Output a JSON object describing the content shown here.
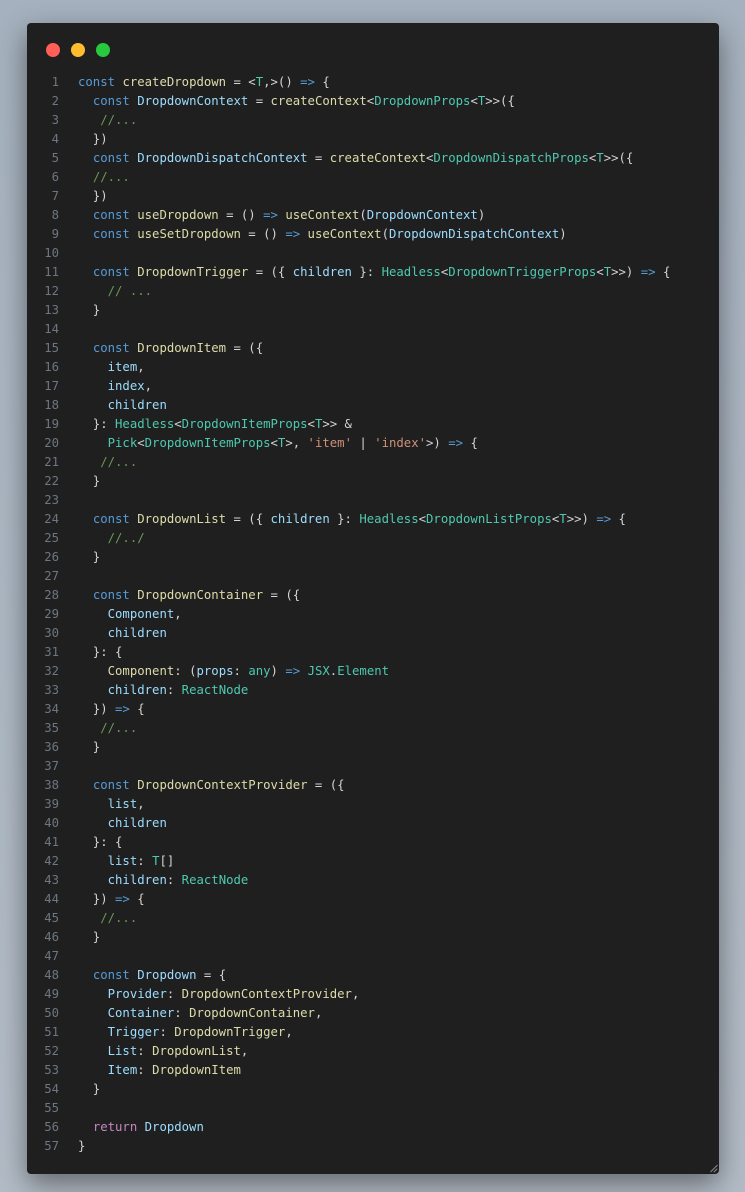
{
  "window": {
    "controls": [
      {
        "name": "close",
        "color": "#ff5f56"
      },
      {
        "name": "minimize",
        "color": "#ffbd2e"
      },
      {
        "name": "zoom",
        "color": "#27c93f"
      }
    ]
  },
  "code": {
    "language": "typescript",
    "lines": [
      {
        "n": "1",
        "tokens": [
          [
            "k",
            "const"
          ],
          [
            "p",
            " "
          ],
          [
            "f",
            "createDropdown"
          ],
          [
            "p",
            " = <"
          ],
          [
            "t",
            "T"
          ],
          [
            "p",
            ",>() "
          ],
          [
            "k",
            "=>"
          ],
          [
            "p",
            " {"
          ]
        ]
      },
      {
        "n": "2",
        "tokens": [
          [
            "p",
            "  "
          ],
          [
            "k",
            "const"
          ],
          [
            "p",
            " "
          ],
          [
            "v",
            "DropdownContext"
          ],
          [
            "p",
            " = "
          ],
          [
            "f",
            "createContext"
          ],
          [
            "p",
            "<"
          ],
          [
            "t",
            "DropdownProps"
          ],
          [
            "p",
            "<"
          ],
          [
            "t",
            "T"
          ],
          [
            "p",
            ">>({"
          ]
        ]
      },
      {
        "n": "3",
        "tokens": [
          [
            "p",
            "   "
          ],
          [
            "c",
            "//..."
          ]
        ]
      },
      {
        "n": "4",
        "tokens": [
          [
            "p",
            "  })"
          ]
        ]
      },
      {
        "n": "5",
        "tokens": [
          [
            "p",
            "  "
          ],
          [
            "k",
            "const"
          ],
          [
            "p",
            " "
          ],
          [
            "v",
            "DropdownDispatchContext"
          ],
          [
            "p",
            " = "
          ],
          [
            "f",
            "createContext"
          ],
          [
            "p",
            "<"
          ],
          [
            "t",
            "DropdownDispatchProps"
          ],
          [
            "p",
            "<"
          ],
          [
            "t",
            "T"
          ],
          [
            "p",
            ">>({"
          ]
        ]
      },
      {
        "n": "6",
        "tokens": [
          [
            "p",
            "  "
          ],
          [
            "c",
            "//..."
          ]
        ]
      },
      {
        "n": "7",
        "tokens": [
          [
            "p",
            "  })"
          ]
        ]
      },
      {
        "n": "8",
        "tokens": [
          [
            "p",
            "  "
          ],
          [
            "k",
            "const"
          ],
          [
            "p",
            " "
          ],
          [
            "f",
            "useDropdown"
          ],
          [
            "p",
            " = () "
          ],
          [
            "k",
            "=>"
          ],
          [
            "p",
            " "
          ],
          [
            "f",
            "useContext"
          ],
          [
            "p",
            "("
          ],
          [
            "v",
            "DropdownContext"
          ],
          [
            "p",
            ")"
          ]
        ]
      },
      {
        "n": "9",
        "tokens": [
          [
            "p",
            "  "
          ],
          [
            "k",
            "const"
          ],
          [
            "p",
            " "
          ],
          [
            "f",
            "useSetDropdown"
          ],
          [
            "p",
            " = () "
          ],
          [
            "k",
            "=>"
          ],
          [
            "p",
            " "
          ],
          [
            "f",
            "useContext"
          ],
          [
            "p",
            "("
          ],
          [
            "v",
            "DropdownDispatchContext"
          ],
          [
            "p",
            ")"
          ]
        ]
      },
      {
        "n": "10",
        "tokens": []
      },
      {
        "n": "11",
        "tokens": [
          [
            "p",
            "  "
          ],
          [
            "k",
            "const"
          ],
          [
            "p",
            " "
          ],
          [
            "f",
            "DropdownTrigger"
          ],
          [
            "p",
            " = ({ "
          ],
          [
            "v",
            "children"
          ],
          [
            "p",
            " }: "
          ],
          [
            "t",
            "Headless"
          ],
          [
            "p",
            "<"
          ],
          [
            "t",
            "DropdownTriggerProps"
          ],
          [
            "p",
            "<"
          ],
          [
            "t",
            "T"
          ],
          [
            "p",
            ">>) "
          ],
          [
            "k",
            "=>"
          ],
          [
            "p",
            " {"
          ]
        ]
      },
      {
        "n": "12",
        "tokens": [
          [
            "p",
            "    "
          ],
          [
            "c",
            "// ..."
          ]
        ]
      },
      {
        "n": "13",
        "tokens": [
          [
            "p",
            "  }"
          ]
        ]
      },
      {
        "n": "14",
        "tokens": []
      },
      {
        "n": "15",
        "tokens": [
          [
            "p",
            "  "
          ],
          [
            "k",
            "const"
          ],
          [
            "p",
            " "
          ],
          [
            "f",
            "DropdownItem"
          ],
          [
            "p",
            " = ({"
          ]
        ]
      },
      {
        "n": "16",
        "tokens": [
          [
            "p",
            "    "
          ],
          [
            "v",
            "item"
          ],
          [
            "p",
            ","
          ]
        ]
      },
      {
        "n": "17",
        "tokens": [
          [
            "p",
            "    "
          ],
          [
            "v",
            "index"
          ],
          [
            "p",
            ","
          ]
        ]
      },
      {
        "n": "18",
        "tokens": [
          [
            "p",
            "    "
          ],
          [
            "v",
            "children"
          ]
        ]
      },
      {
        "n": "19",
        "tokens": [
          [
            "p",
            "  }: "
          ],
          [
            "t",
            "Headless"
          ],
          [
            "p",
            "<"
          ],
          [
            "t",
            "DropdownItemProps"
          ],
          [
            "p",
            "<"
          ],
          [
            "t",
            "T"
          ],
          [
            "p",
            ">> &"
          ]
        ]
      },
      {
        "n": "20",
        "tokens": [
          [
            "p",
            "    "
          ],
          [
            "t",
            "Pick"
          ],
          [
            "p",
            "<"
          ],
          [
            "t",
            "DropdownItemProps"
          ],
          [
            "p",
            "<"
          ],
          [
            "t",
            "T"
          ],
          [
            "p",
            ">, "
          ],
          [
            "s",
            "'item'"
          ],
          [
            "p",
            " | "
          ],
          [
            "s",
            "'index'"
          ],
          [
            "p",
            ">) "
          ],
          [
            "k",
            "=>"
          ],
          [
            "p",
            " {"
          ]
        ]
      },
      {
        "n": "21",
        "tokens": [
          [
            "p",
            "   "
          ],
          [
            "c",
            "//..."
          ]
        ]
      },
      {
        "n": "22",
        "tokens": [
          [
            "p",
            "  }"
          ]
        ]
      },
      {
        "n": "23",
        "tokens": []
      },
      {
        "n": "24",
        "tokens": [
          [
            "p",
            "  "
          ],
          [
            "k",
            "const"
          ],
          [
            "p",
            " "
          ],
          [
            "f",
            "DropdownList"
          ],
          [
            "p",
            " = ({ "
          ],
          [
            "v",
            "children"
          ],
          [
            "p",
            " }: "
          ],
          [
            "t",
            "Headless"
          ],
          [
            "p",
            "<"
          ],
          [
            "t",
            "DropdownListProps"
          ],
          [
            "p",
            "<"
          ],
          [
            "t",
            "T"
          ],
          [
            "p",
            ">>) "
          ],
          [
            "k",
            "=>"
          ],
          [
            "p",
            " {"
          ]
        ]
      },
      {
        "n": "25",
        "tokens": [
          [
            "p",
            "    "
          ],
          [
            "c",
            "//../"
          ]
        ]
      },
      {
        "n": "26",
        "tokens": [
          [
            "p",
            "  }"
          ]
        ]
      },
      {
        "n": "27",
        "tokens": []
      },
      {
        "n": "28",
        "tokens": [
          [
            "p",
            "  "
          ],
          [
            "k",
            "const"
          ],
          [
            "p",
            " "
          ],
          [
            "f",
            "DropdownContainer"
          ],
          [
            "p",
            " = ({"
          ]
        ]
      },
      {
        "n": "29",
        "tokens": [
          [
            "p",
            "    "
          ],
          [
            "v",
            "Component"
          ],
          [
            "p",
            ","
          ]
        ]
      },
      {
        "n": "30",
        "tokens": [
          [
            "p",
            "    "
          ],
          [
            "v",
            "children"
          ]
        ]
      },
      {
        "n": "31",
        "tokens": [
          [
            "p",
            "  }: {"
          ]
        ]
      },
      {
        "n": "32",
        "tokens": [
          [
            "p",
            "    "
          ],
          [
            "f",
            "Component"
          ],
          [
            "p",
            ": ("
          ],
          [
            "v",
            "props"
          ],
          [
            "p",
            ": "
          ],
          [
            "t",
            "any"
          ],
          [
            "p",
            ") "
          ],
          [
            "k",
            "=>"
          ],
          [
            "p",
            " "
          ],
          [
            "t",
            "JSX"
          ],
          [
            "p",
            "."
          ],
          [
            "t",
            "Element"
          ]
        ]
      },
      {
        "n": "33",
        "tokens": [
          [
            "p",
            "    "
          ],
          [
            "v",
            "children"
          ],
          [
            "p",
            ": "
          ],
          [
            "t",
            "ReactNode"
          ]
        ]
      },
      {
        "n": "34",
        "tokens": [
          [
            "p",
            "  }) "
          ],
          [
            "k",
            "=>"
          ],
          [
            "p",
            " {"
          ]
        ]
      },
      {
        "n": "35",
        "tokens": [
          [
            "p",
            "   "
          ],
          [
            "c",
            "//..."
          ]
        ]
      },
      {
        "n": "36",
        "tokens": [
          [
            "p",
            "  }"
          ]
        ]
      },
      {
        "n": "37",
        "tokens": []
      },
      {
        "n": "38",
        "tokens": [
          [
            "p",
            "  "
          ],
          [
            "k",
            "const"
          ],
          [
            "p",
            " "
          ],
          [
            "f",
            "DropdownContextProvider"
          ],
          [
            "p",
            " = ({"
          ]
        ]
      },
      {
        "n": "39",
        "tokens": [
          [
            "p",
            "    "
          ],
          [
            "v",
            "list"
          ],
          [
            "p",
            ","
          ]
        ]
      },
      {
        "n": "40",
        "tokens": [
          [
            "p",
            "    "
          ],
          [
            "v",
            "children"
          ]
        ]
      },
      {
        "n": "41",
        "tokens": [
          [
            "p",
            "  }: {"
          ]
        ]
      },
      {
        "n": "42",
        "tokens": [
          [
            "p",
            "    "
          ],
          [
            "v",
            "list"
          ],
          [
            "p",
            ": "
          ],
          [
            "t",
            "T"
          ],
          [
            "p",
            "[]"
          ]
        ]
      },
      {
        "n": "43",
        "tokens": [
          [
            "p",
            "    "
          ],
          [
            "v",
            "children"
          ],
          [
            "p",
            ": "
          ],
          [
            "t",
            "ReactNode"
          ]
        ]
      },
      {
        "n": "44",
        "tokens": [
          [
            "p",
            "  }) "
          ],
          [
            "k",
            "=>"
          ],
          [
            "p",
            " {"
          ]
        ]
      },
      {
        "n": "45",
        "tokens": [
          [
            "p",
            "   "
          ],
          [
            "c",
            "//..."
          ]
        ]
      },
      {
        "n": "46",
        "tokens": [
          [
            "p",
            "  }"
          ]
        ]
      },
      {
        "n": "47",
        "tokens": []
      },
      {
        "n": "48",
        "tokens": [
          [
            "p",
            "  "
          ],
          [
            "k",
            "const"
          ],
          [
            "p",
            " "
          ],
          [
            "v",
            "Dropdown"
          ],
          [
            "p",
            " = {"
          ]
        ]
      },
      {
        "n": "49",
        "tokens": [
          [
            "p",
            "    "
          ],
          [
            "v",
            "Provider"
          ],
          [
            "p",
            ": "
          ],
          [
            "f",
            "DropdownContextProvider"
          ],
          [
            "p",
            ","
          ]
        ]
      },
      {
        "n": "50",
        "tokens": [
          [
            "p",
            "    "
          ],
          [
            "v",
            "Container"
          ],
          [
            "p",
            ": "
          ],
          [
            "f",
            "DropdownContainer"
          ],
          [
            "p",
            ","
          ]
        ]
      },
      {
        "n": "51",
        "tokens": [
          [
            "p",
            "    "
          ],
          [
            "v",
            "Trigger"
          ],
          [
            "p",
            ": "
          ],
          [
            "f",
            "DropdownTrigger"
          ],
          [
            "p",
            ","
          ]
        ]
      },
      {
        "n": "52",
        "tokens": [
          [
            "p",
            "    "
          ],
          [
            "v",
            "List"
          ],
          [
            "p",
            ": "
          ],
          [
            "f",
            "DropdownList"
          ],
          [
            "p",
            ","
          ]
        ]
      },
      {
        "n": "53",
        "tokens": [
          [
            "p",
            "    "
          ],
          [
            "v",
            "Item"
          ],
          [
            "p",
            ": "
          ],
          [
            "f",
            "DropdownItem"
          ]
        ]
      },
      {
        "n": "54",
        "tokens": [
          [
            "p",
            "  }"
          ]
        ]
      },
      {
        "n": "55",
        "tokens": []
      },
      {
        "n": "56",
        "tokens": [
          [
            "p",
            "  "
          ],
          [
            "r",
            "return"
          ],
          [
            "p",
            " "
          ],
          [
            "v",
            "Dropdown"
          ]
        ]
      },
      {
        "n": "57",
        "tokens": [
          [
            "p",
            "}"
          ]
        ]
      }
    ]
  }
}
